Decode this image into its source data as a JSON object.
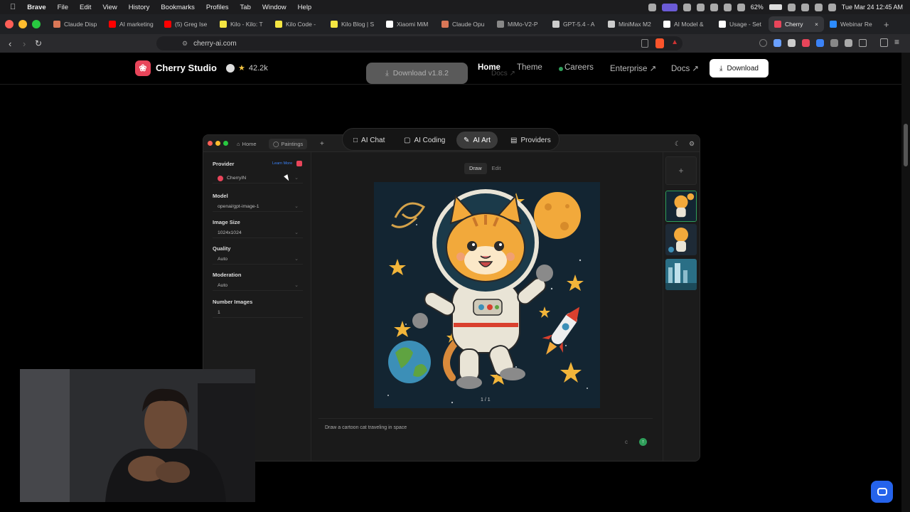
{
  "menubar": {
    "app": "Brave",
    "items": [
      "File",
      "Edit",
      "View",
      "History",
      "Bookmarks",
      "Profiles",
      "Tab",
      "Window",
      "Help"
    ],
    "battery": "62%",
    "datetime": "Tue Mar 24  12:45 AM"
  },
  "tabs": [
    {
      "label": "Claude Disp",
      "color": "#d97757"
    },
    {
      "label": "AI marketing",
      "color": "#ff0000"
    },
    {
      "label": "(5) Greg Ise",
      "color": "#ff0000"
    },
    {
      "label": "Kilo - Kilo: T",
      "color": "#f5e642"
    },
    {
      "label": "Kilo Code -",
      "color": "#f5e642"
    },
    {
      "label": "Kilo Blog | S",
      "color": "#f5e642"
    },
    {
      "label": "Xiaomi MiM",
      "color": "#ffffff"
    },
    {
      "label": "Claude Opu",
      "color": "#d97757"
    },
    {
      "label": "MiMo-V2-P",
      "color": "#888888"
    },
    {
      "label": "GPT-5.4 - A",
      "color": "#cccccc"
    },
    {
      "label": "MiniMax M2",
      "color": "#cccccc"
    },
    {
      "label": "AI Model &",
      "color": "#ffffff"
    },
    {
      "label": "Usage - Set",
      "color": "#ffffff"
    },
    {
      "label": "Cherry",
      "color": "#e8455a",
      "active": true
    },
    {
      "label": "Webinar Re",
      "color": "#2d8cff"
    }
  ],
  "address": {
    "url": "cherry-ai.com"
  },
  "site": {
    "brand": "Cherry Studio",
    "stars": "42.2k",
    "ghost_download": "Download v1.8.2",
    "ghost_docs": "Docs ↗",
    "nav": {
      "home": "Home",
      "theme": "Theme",
      "careers": "Careers",
      "enterprise": "Enterprise ↗",
      "docs": "Docs ↗",
      "download": "Download"
    }
  },
  "pills": {
    "chat": "AI Chat",
    "coding": "AI Coding",
    "art": "AI Art",
    "providers": "Providers"
  },
  "app": {
    "tabs": {
      "home": "Home",
      "paintings": "Paintings"
    },
    "provider_label": "Provider",
    "learn_more": "Learn More",
    "provider_value": "CherryIN",
    "model_label": "Model",
    "model_value": "openai/gpt-image-1",
    "size_label": "Image Size",
    "size_value": "1024x1024",
    "quality_label": "Quality",
    "quality_value": "Auto",
    "moderation_label": "Moderation",
    "moderation_value": "Auto",
    "count_label": "Number Images",
    "count_value": "1",
    "mode_draw": "Draw",
    "mode_edit": "Edit",
    "pager": "1 / 1",
    "prompt": "Draw a cartoon cat traveling in space"
  },
  "colors": {
    "brand": "#e8455a",
    "accent_green": "#2f9e5a",
    "fab_blue": "#2563eb"
  }
}
